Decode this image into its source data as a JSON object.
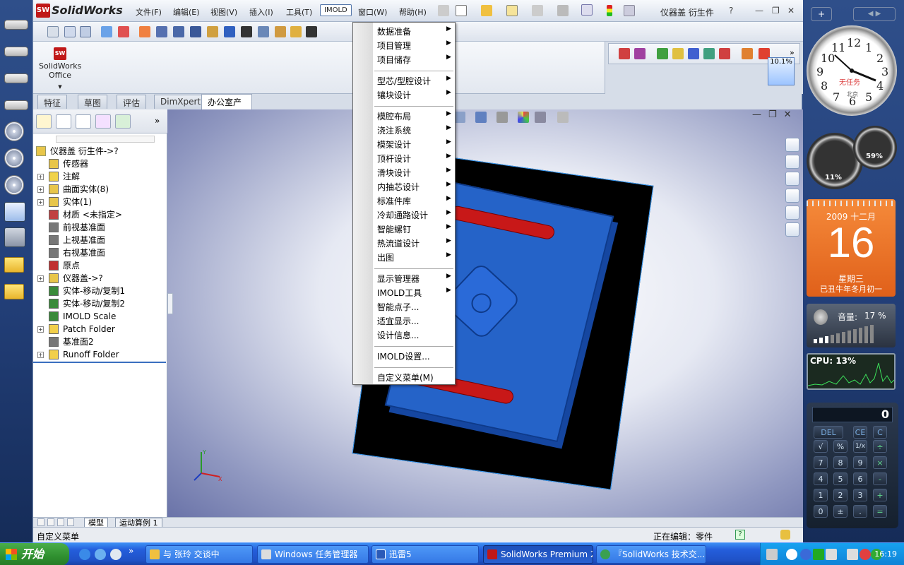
{
  "app": {
    "logo_text": "SW",
    "name": "SolidWorks",
    "document_title": "仪器盖 衍生件",
    "help_label": "?"
  },
  "menubar": [
    "文件(F)",
    "编辑(E)",
    "视图(V)",
    "插入(I)",
    "工具(T)",
    "IMOLD",
    "窗口(W)",
    "帮助(H)"
  ],
  "office_button": {
    "label_line1": "SolidWorks",
    "label_line2": "Office"
  },
  "zoom_chip": "10.1%",
  "cm_tabs": [
    "特征",
    "草图",
    "评估",
    "DimXpert",
    "办公室产品"
  ],
  "imold_menu": {
    "group1": [
      "数据准备",
      "项目管理",
      "项目储存"
    ],
    "group2": [
      "型芯/型腔设计",
      "镶块设计"
    ],
    "group3": [
      "模腔布局",
      "浇注系统",
      "模架设计",
      "顶杆设计",
      "滑块设计",
      "内抽芯设计",
      "标准件库",
      "冷却通路设计",
      "智能螺钉",
      "热流道设计",
      "出图"
    ],
    "group4": [
      "显示管理器",
      "IMOLD工具",
      "智能点子...",
      "适宜显示...",
      "设计信息..."
    ],
    "group5": [
      "IMOLD设置..."
    ],
    "group6": [
      "自定义菜单(M)"
    ]
  },
  "tree": {
    "root": "仪器盖 衍生件->?",
    "items": [
      {
        "label": "传感器",
        "expand": false,
        "icon": "sensor-icon",
        "color": "#e8c64a"
      },
      {
        "label": "注解",
        "expand": true,
        "icon": "annotation-icon",
        "color": "#f0d24a"
      },
      {
        "label": "曲面实体(8)",
        "expand": true,
        "icon": "surface-bodies-icon",
        "color": "#e8c64a"
      },
      {
        "label": "实体(1)",
        "expand": true,
        "icon": "solid-bodies-icon",
        "color": "#e8c64a"
      },
      {
        "label": "材质 <未指定>",
        "expand": false,
        "icon": "material-icon",
        "color": "#c04040"
      },
      {
        "label": "前视基准面",
        "expand": false,
        "icon": "plane-icon",
        "color": "#777777"
      },
      {
        "label": "上视基准面",
        "expand": false,
        "icon": "plane-icon",
        "color": "#777777"
      },
      {
        "label": "右视基准面",
        "expand": false,
        "icon": "plane-icon",
        "color": "#777777"
      },
      {
        "label": "原点",
        "expand": false,
        "icon": "origin-icon",
        "color": "#c03030"
      },
      {
        "label": "仪器盖->?",
        "expand": true,
        "icon": "part-icon",
        "color": "#e8c64a"
      },
      {
        "label": "实体-移动/复制1",
        "expand": false,
        "icon": "move-copy-icon",
        "color": "#3a8a3a"
      },
      {
        "label": "实体-移动/复制2",
        "expand": false,
        "icon": "move-copy-icon",
        "color": "#3a8a3a"
      },
      {
        "label": "IMOLD Scale",
        "expand": false,
        "icon": "scale-icon",
        "color": "#3a8a3a"
      },
      {
        "label": "Patch Folder",
        "expand": true,
        "icon": "folder-icon",
        "color": "#f2cf4a"
      },
      {
        "label": "基准面2",
        "expand": false,
        "icon": "plane-icon",
        "color": "#777777"
      },
      {
        "label": "Runoff Folder",
        "expand": true,
        "icon": "folder-icon",
        "color": "#f2cf4a"
      }
    ]
  },
  "triad": {
    "x": "X",
    "y": "Y"
  },
  "sheet_tabs": [
    "模型",
    "运动算例 1"
  ],
  "status": {
    "left": "自定义菜单",
    "editing": "正在编辑：零件",
    "help": "?"
  },
  "gadgets": {
    "clock_numbers": [
      "12",
      "1",
      "2",
      "3",
      "4",
      "5",
      "6",
      "7",
      "8",
      "9",
      "10",
      "11"
    ],
    "clock_brand": "无任务",
    "clock_city": "北京",
    "cpu_gauge": "11%",
    "ram_gauge": "59%",
    "calendar_month": "2009 十二月",
    "calendar_day": "16",
    "calendar_weekday": "星期三",
    "calendar_lunar": "已丑牛年冬月初一",
    "volume_label": "音量:",
    "volume_value": "17 %",
    "cpu_label": "CPU: 13%",
    "calc_display": "0",
    "calc_keys": [
      [
        "DEL",
        "CE",
        "C"
      ],
      [
        "√",
        "%",
        "1/x",
        "÷"
      ],
      [
        "7",
        "8",
        "9",
        "×"
      ],
      [
        "4",
        "5",
        "6",
        "-"
      ],
      [
        "1",
        "2",
        "3",
        "+"
      ],
      [
        "0",
        "±",
        ".",
        "="
      ]
    ]
  },
  "taskbar": {
    "start": "开始",
    "tasks": [
      "与 张玲 交谈中",
      "Windows 任务管理器",
      "迅雷5",
      "SolidWorks Premium 2...",
      "『SolidWorks 技术交..."
    ],
    "time": "16:19"
  },
  "colors": {
    "plate": "#000000",
    "part": "#2563c8",
    "slot": "#c81818",
    "accent": "#3a6fc0"
  }
}
